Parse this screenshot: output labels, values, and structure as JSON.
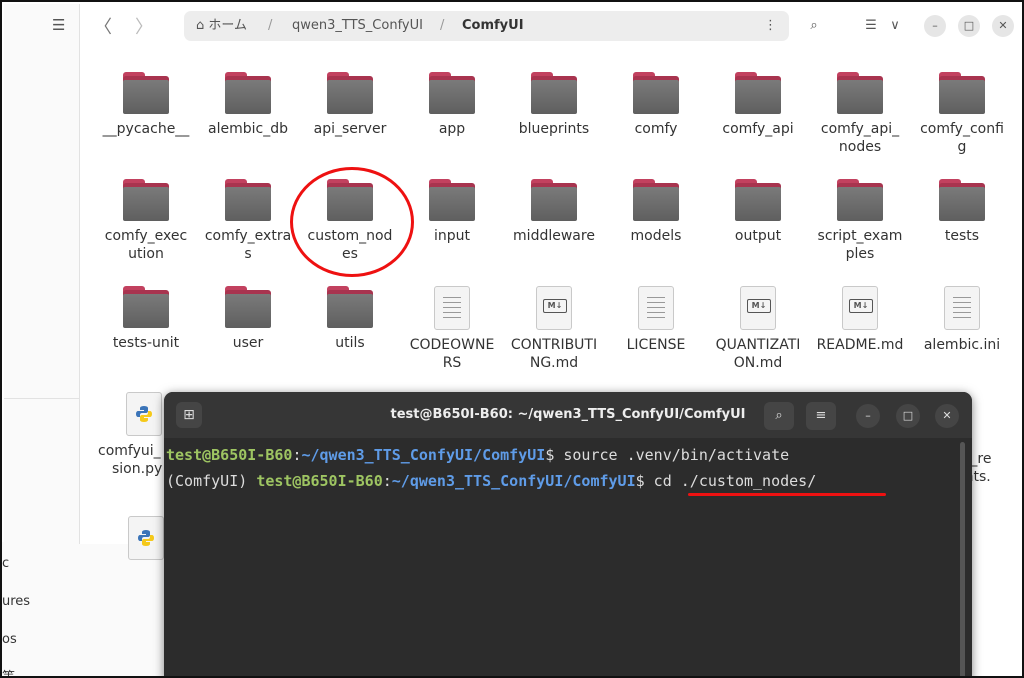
{
  "background": {
    "texts": [
      "c",
      "ures",
      "os",
      "等"
    ]
  },
  "file_manager": {
    "nav_back": "〈",
    "nav_forward": "〉",
    "path": {
      "home": "⌂ ホーム",
      "sep": "/",
      "seg1": "qwen3_TTS_ConfyUI",
      "seg2": "ComfyUI",
      "more": "⋮"
    },
    "header_icons": {
      "search": "⌕",
      "view": "☰",
      "view_menu": "∨",
      "minimize": "–",
      "maximize": "□",
      "close": "✕"
    },
    "items": [
      {
        "name": "__pycache__",
        "type": "folder"
      },
      {
        "name": "alembic_db",
        "type": "folder"
      },
      {
        "name": "api_server",
        "type": "folder"
      },
      {
        "name": "app",
        "type": "folder"
      },
      {
        "name": "blueprints",
        "type": "folder"
      },
      {
        "name": "comfy",
        "type": "folder"
      },
      {
        "name": "comfy_api",
        "type": "folder"
      },
      {
        "name": "comfy_api_\nnodes",
        "type": "folder"
      },
      {
        "name": "comfy_confi\ng",
        "type": "folder"
      },
      {
        "name": "comfy_exec\nution",
        "type": "folder"
      },
      {
        "name": "comfy_extra\ns",
        "type": "folder"
      },
      {
        "name": "custom_nod\nes",
        "type": "folder"
      },
      {
        "name": "input",
        "type": "folder"
      },
      {
        "name": "middleware",
        "type": "folder"
      },
      {
        "name": "models",
        "type": "folder"
      },
      {
        "name": "output",
        "type": "folder"
      },
      {
        "name": "script_exam\nples",
        "type": "folder"
      },
      {
        "name": "tests",
        "type": "folder"
      },
      {
        "name": "tests-unit",
        "type": "folder"
      },
      {
        "name": "user",
        "type": "folder"
      },
      {
        "name": "utils",
        "type": "folder"
      },
      {
        "name": "CODEOWNE\nRS",
        "type": "text"
      },
      {
        "name": "CONTRIBUTI\nNG.md",
        "type": "md"
      },
      {
        "name": "LICENSE",
        "type": "text"
      },
      {
        "name": "QUANTIZATI\nON.md",
        "type": "md"
      },
      {
        "name": "README.md",
        "type": "md"
      },
      {
        "name": "alembic.ini",
        "type": "text"
      }
    ],
    "partial_items": {
      "left_label_1": "comfyui_",
      "left_label_2": "sion.py",
      "right_label_1": "er_re",
      "right_label_2": "ents."
    }
  },
  "terminal": {
    "title": "test@B650I-B60: ~/qwen3_TTS_ConfyUI/ComfyUI",
    "buttons": {
      "new_tab": "⊞",
      "search": "⌕",
      "menu": "≡",
      "minimize": "–",
      "maximize": "□",
      "close": "✕"
    },
    "line1": {
      "user": "test@B650I-B60",
      "colon": ":",
      "path": "~/qwen3_TTS_ConfyUI/ComfyUI",
      "cmd": "$ source .venv/bin/activate"
    },
    "line2": {
      "venv": "(ComfyUI) ",
      "user": "test@B650I-B60",
      "colon": ":",
      "path": "~/qwen3_TTS_ConfyUI/ComfyUI",
      "cmd": "$ cd ./custom_nodes/"
    }
  },
  "colors": {
    "annotation": "#e11111",
    "folder_tab": "#c2415f",
    "prompt_user": "#9ec562",
    "prompt_path": "#5f9ce8",
    "terminal_bg": "#2c2c2c"
  }
}
